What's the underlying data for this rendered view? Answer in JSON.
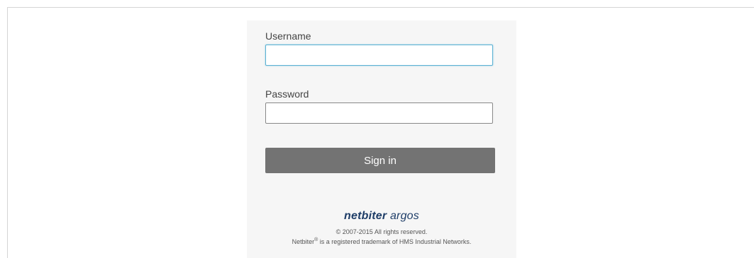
{
  "login": {
    "username_label": "Username",
    "username_value": "",
    "password_label": "Password",
    "password_value": "",
    "sign_in_label": "Sign in"
  },
  "footer": {
    "logo_main": "netbiter",
    "logo_sub": " argos",
    "copyright": "© 2007-2015 All rights reserved.",
    "trademark_brand": "Netbiter",
    "trademark_symbol": "®",
    "trademark_rest": " is a registered trademark of HMS Industrial Networks."
  },
  "colors": {
    "panel_bg": "#f6f6f6",
    "button_bg": "#737373",
    "focus_border": "#5ab1d3",
    "logo_blue": "#1f3e68",
    "logo_orange": "#f0a030"
  }
}
